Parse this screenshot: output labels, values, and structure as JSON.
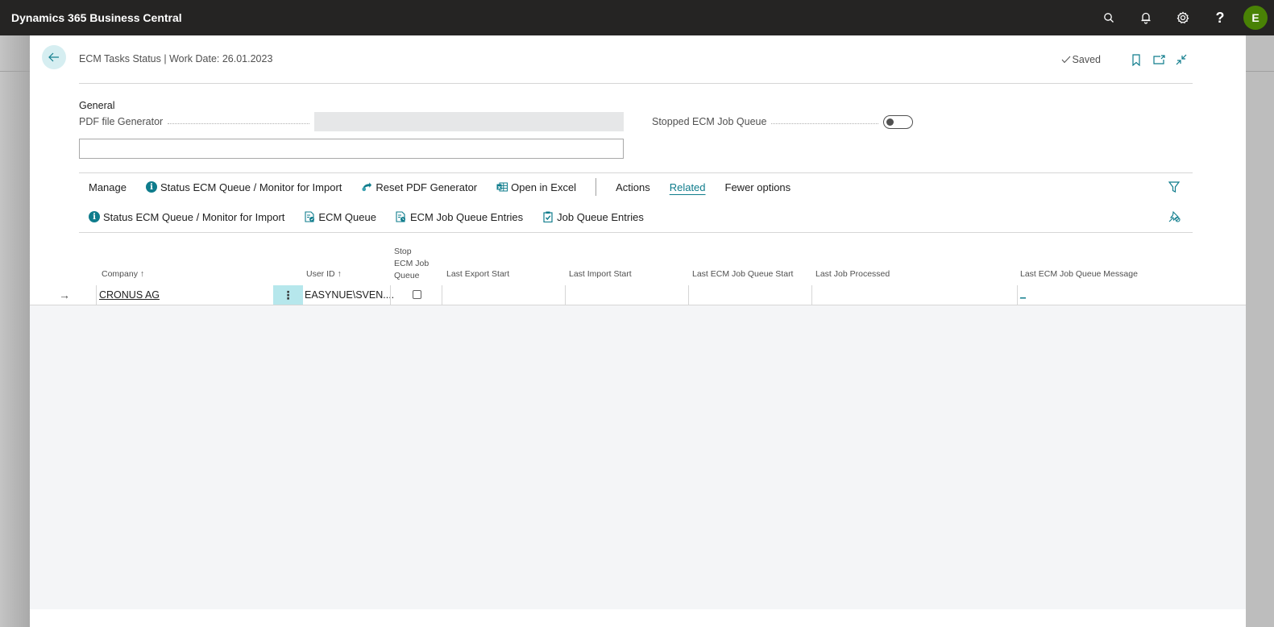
{
  "app": {
    "title": "Dynamics 365 Business Central",
    "user_initial": "E",
    "top_icons": [
      "search-icon",
      "bell-icon",
      "gear-icon",
      "help-icon"
    ],
    "help_label": "?"
  },
  "header": {
    "title": "ECM Tasks Status | Work Date: 26.01.2023",
    "saved_label": "Saved",
    "icons": [
      "bookmark-icon",
      "open-new-window-icon",
      "collapse-icon"
    ]
  },
  "general": {
    "title": "General",
    "pdf_generator_label": "PDF file Generator",
    "pdf_generator_value": "",
    "text_box_value": "",
    "stopped_queue_label": "Stopped ECM Job Queue",
    "stopped_queue_on": false
  },
  "actions": {
    "row1": [
      {
        "label": "Manage",
        "icon": ""
      },
      {
        "label": "Status ECM Queue / Monitor for Import",
        "icon": "info-icon"
      },
      {
        "label": "Reset PDF Generator",
        "icon": "reset-icon"
      },
      {
        "label": "Open in Excel",
        "icon": "excel-icon"
      },
      {
        "label": "Actions",
        "icon": ""
      },
      {
        "label": "Related",
        "icon": ""
      },
      {
        "label": "Fewer options",
        "icon": ""
      }
    ],
    "row2": [
      {
        "label": "Status ECM Queue / Monitor for Import",
        "icon": "info-icon"
      },
      {
        "label": "ECM Queue",
        "icon": "queue-icon"
      },
      {
        "label": "ECM Job Queue Entries",
        "icon": "job-queue-icon"
      },
      {
        "label": "Job Queue Entries",
        "icon": "clipboard-check-icon"
      }
    ]
  },
  "grid": {
    "columns": [
      {
        "label": "Company",
        "sort": "↑"
      },
      {
        "label": "User ID",
        "sort": "↑"
      },
      {
        "label": "Stop ECM Job Queue",
        "lines": [
          "Stop",
          "ECM Job",
          "Queue"
        ]
      },
      {
        "label": "Last Export Start"
      },
      {
        "label": "Last Import Start"
      },
      {
        "label": "Last ECM Job Queue Start"
      },
      {
        "label": "Last Job Processed"
      },
      {
        "label": "Last ECM Job Queue Message"
      }
    ],
    "rows": [
      {
        "company": "CRONUS AG",
        "user_id": "EASYNUE\\SVEN....",
        "stop_queue": false,
        "last_export_start": "",
        "last_import_start": "",
        "last_ecm_job_queue_start": "",
        "last_job_processed": "",
        "last_ecm_job_queue_message": "_"
      }
    ]
  },
  "colors": {
    "accent": "#0f7c8c",
    "topbar": "#252423",
    "avatar": "#498205",
    "row_menu": "#b6e7ec"
  }
}
